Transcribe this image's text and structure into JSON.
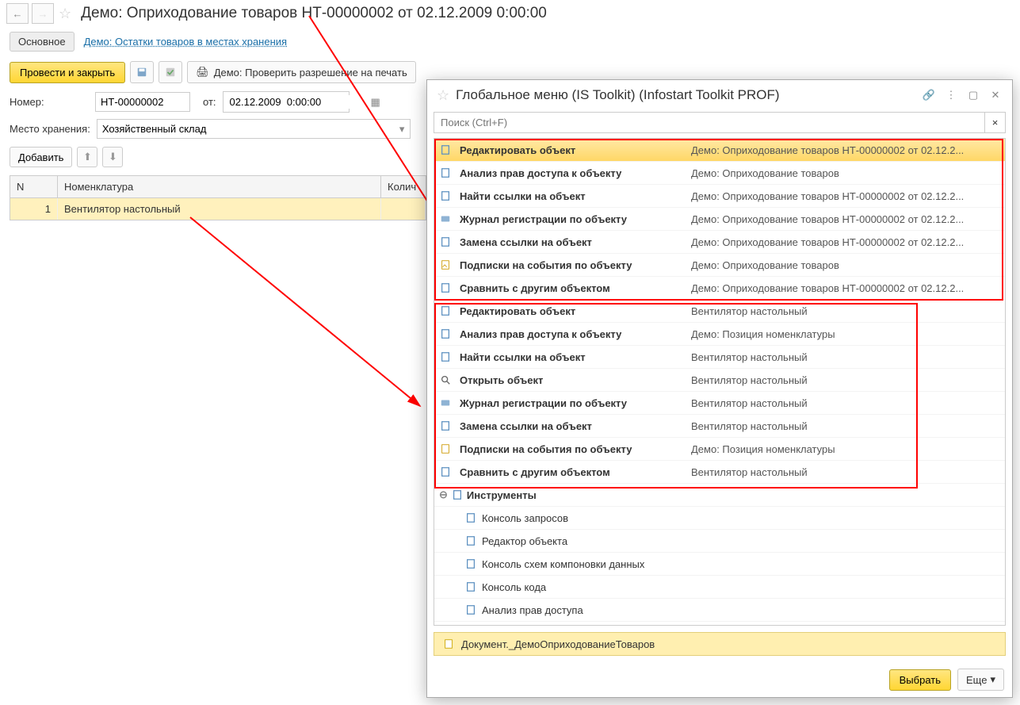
{
  "header": {
    "title": "Демо: Оприходование товаров НТ-00000002 от 02.12.2009 0:00:00"
  },
  "tabs": {
    "main": "Основное",
    "link": "Демо: Остатки товаров в местах хранения"
  },
  "toolbar": {
    "post_close": "Провести и закрыть",
    "check_print": "Демо: Проверить разрешение на печать"
  },
  "form": {
    "number_label": "Номер:",
    "number_value": "НТ-00000002",
    "from_label": "от:",
    "date_value": "02.12.2009  0:00:00",
    "storage_label": "Место хранения:",
    "storage_value": "Хозяйственный склад"
  },
  "table": {
    "add_btn": "Добавить",
    "col_n": "N",
    "col_nom": "Номенклатура",
    "col_qty": "Колич",
    "row_n": "1",
    "row_nom": "Вентилятор настольный"
  },
  "popup": {
    "title": "Глобальное меню (IS Toolkit) (Infostart Toolkit PROF)",
    "search_placeholder": "Поиск (Ctrl+F)",
    "group1": [
      {
        "label": "Редактировать объект",
        "desc": "Демо: Оприходование товаров НТ-00000002 от 02.12.2..."
      },
      {
        "label": "Анализ прав доступа к объекту",
        "desc": "Демо: Оприходование товаров"
      },
      {
        "label": "Найти ссылки на объект",
        "desc": "Демо: Оприходование товаров НТ-00000002 от 02.12.2..."
      },
      {
        "label": "Журнал регистрации по объекту",
        "desc": "Демо: Оприходование товаров НТ-00000002 от 02.12.2..."
      },
      {
        "label": "Замена ссылки на объект",
        "desc": "Демо: Оприходование товаров НТ-00000002 от 02.12.2..."
      },
      {
        "label": "Подписки на события по объекту",
        "desc": "Демо: Оприходование товаров"
      },
      {
        "label": "Сравнить с другим объектом",
        "desc": "Демо: Оприходование товаров НТ-00000002 от 02.12.2..."
      }
    ],
    "group2": [
      {
        "label": "Редактировать объект",
        "desc": "Вентилятор настольный"
      },
      {
        "label": "Анализ прав доступа к объекту",
        "desc": "Демо: Позиция номенклатуры"
      },
      {
        "label": "Найти ссылки на объект",
        "desc": "Вентилятор настольный"
      },
      {
        "label": "Открыть объект",
        "desc": "Вентилятор настольный"
      },
      {
        "label": "Журнал регистрации по объекту",
        "desc": "Вентилятор настольный"
      },
      {
        "label": "Замена ссылки на объект",
        "desc": "Вентилятор настольный"
      },
      {
        "label": "Подписки на события по объекту",
        "desc": "Демо: Позиция номенклатуры"
      },
      {
        "label": "Сравнить с другим объектом",
        "desc": "Вентилятор настольный"
      }
    ],
    "tools_label": "Инструменты",
    "tools": [
      "Консоль запросов",
      "Редактор объекта",
      "Консоль схем компоновки данных",
      "Консоль кода",
      "Анализ прав доступа"
    ],
    "footer_text": "Документ._ДемоОприходованиеТоваров",
    "select_btn": "Выбрать",
    "more_btn": "Еще"
  }
}
